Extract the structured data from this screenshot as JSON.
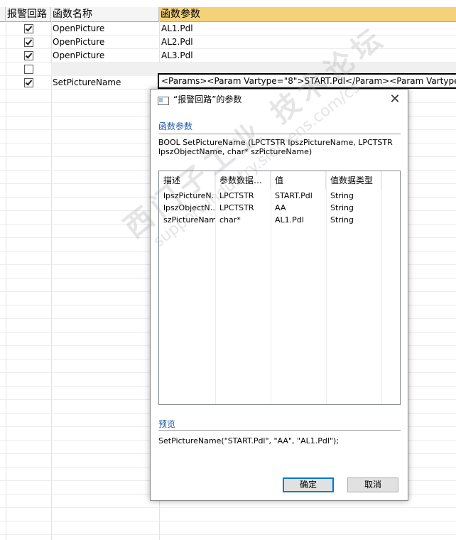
{
  "grid": {
    "columns": [
      "报警回路",
      "函数名称",
      "函数参数"
    ],
    "rows": [
      {
        "checked": true,
        "function": "OpenPicture",
        "param": "AL1.Pdl"
      },
      {
        "checked": true,
        "function": "OpenPicture",
        "param": "AL2.Pdl"
      },
      {
        "checked": true,
        "function": "OpenPicture",
        "param": "AL3.Pdl"
      },
      {
        "checked": false,
        "function": "",
        "param": ""
      },
      {
        "checked": true,
        "function": "SetPictureName",
        "param": "<Params><Param Vartype=\"8\">START.Pdl</Param><Param Vartype="
      }
    ]
  },
  "dialog": {
    "title": "“报警回路”的参数",
    "close_symbol": "✕",
    "function_section": "函数参数",
    "signature": "BOOL SetPictureName (LPCTSTR lpszPictureName, LPCTSTR lpszObjectName, char* szPictureName)",
    "param_table": {
      "headers": [
        "描述",
        "参数数据…",
        "值",
        "值数据类型"
      ],
      "rows": [
        [
          "lpszPictureN…",
          "LPCTSTR",
          "START.Pdl",
          "String"
        ],
        [
          "lpszObjectN…",
          "LPCTSTR",
          "AA",
          "String"
        ],
        [
          "szPictureName",
          "char*",
          "AL1.Pdl",
          "String"
        ]
      ]
    },
    "preview_section": "预览",
    "preview_text": "SetPictureName(\"START.Pdl\", \"AA\", \"AL1.Pdl\");",
    "ok_label": "确定",
    "cancel_label": "取消"
  },
  "watermark": {
    "line1": "西门子工业  技术论坛",
    "line2": "support.industry.siemens.com/cs"
  },
  "colors": {
    "header_highlight": "#f5d27a",
    "section_title": "#1a5aa8",
    "primary_border": "#0078d7"
  }
}
